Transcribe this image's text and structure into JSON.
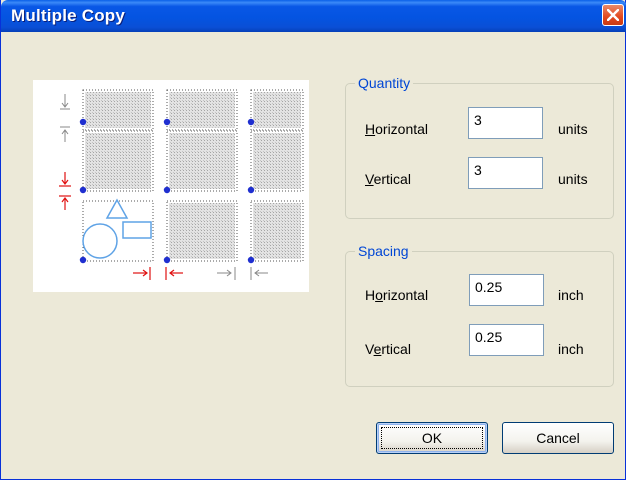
{
  "window": {
    "title": "Multiple Copy",
    "close_icon": "close-icon"
  },
  "quantity": {
    "group_label": "Quantity",
    "horizontal": {
      "label_first": "H",
      "label_rest": "orizontal",
      "value": "3",
      "unit": "units"
    },
    "vertical": {
      "label_first": "V",
      "label_rest": "ertical",
      "value": "3",
      "unit": "units"
    }
  },
  "spacing": {
    "group_label": "Spacing",
    "horizontal": {
      "label_before": "H",
      "label_mnemonic": "o",
      "label_after": "rizontal",
      "value": "0.25",
      "unit": "inch"
    },
    "vertical": {
      "label_before": "V",
      "label_mnemonic": "e",
      "label_after": "rtical",
      "value": "0.25",
      "unit": "inch"
    }
  },
  "buttons": {
    "ok": "OK",
    "cancel": "Cancel"
  },
  "colors": {
    "title_bar": "#0a5fe8",
    "group_label": "#0046d5",
    "dialog_bg": "#ece9d8",
    "marker_blue": "#1f2fd0",
    "arrow_red": "#e01010"
  }
}
